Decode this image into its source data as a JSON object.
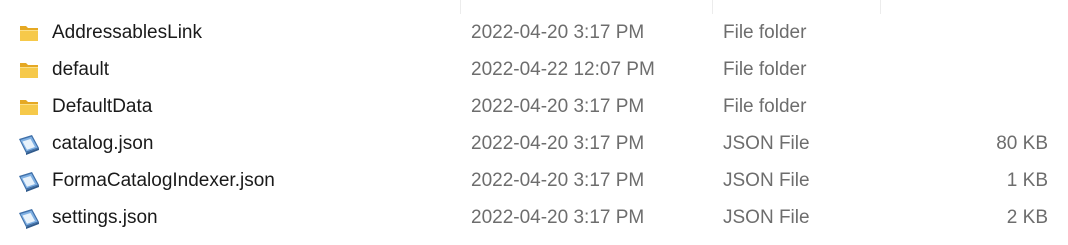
{
  "files": [
    {
      "icon": "folder-icon",
      "name": "AddressablesLink",
      "date": "2022-04-20 3:17 PM",
      "type": "File folder",
      "size": ""
    },
    {
      "icon": "folder-icon",
      "name": "default",
      "date": "2022-04-22 12:07 PM",
      "type": "File folder",
      "size": ""
    },
    {
      "icon": "folder-icon",
      "name": "DefaultData",
      "date": "2022-04-20 3:17 PM",
      "type": "File folder",
      "size": ""
    },
    {
      "icon": "json-file-icon",
      "name": "catalog.json",
      "date": "2022-04-20 3:17 PM",
      "type": "JSON File",
      "size": "80 KB"
    },
    {
      "icon": "json-file-icon",
      "name": "FormaCatalogIndexer.json",
      "date": "2022-04-20 3:17 PM",
      "type": "JSON File",
      "size": "1 KB"
    },
    {
      "icon": "json-file-icon",
      "name": "settings.json",
      "date": "2022-04-20 3:17 PM",
      "type": "JSON File",
      "size": "2 KB"
    }
  ],
  "colors": {
    "folder": "#f6c94a",
    "folder_dark": "#e5a823",
    "file_blue": "#4a86c8",
    "text_primary": "#1a1a1a",
    "text_secondary": "#6d6d6d",
    "hover": "#e5f3ff"
  }
}
